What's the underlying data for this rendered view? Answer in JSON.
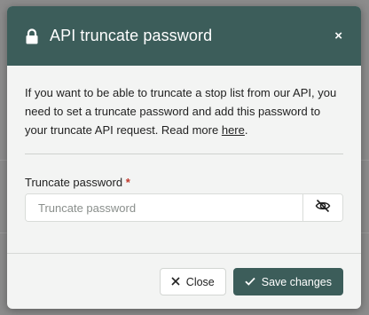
{
  "modal": {
    "title": "API truncate password",
    "close_glyph": "×",
    "header_icon": "lock-icon",
    "colors": {
      "header_bg": "#3c5d5a",
      "primary_button": "#3c5d5a",
      "required": "#c0392b"
    }
  },
  "body": {
    "intro_text": "If you want to be able to truncate a stop list from our API, you need to set a truncate password and add this password to your truncate API request. Read more ",
    "intro_link": "here",
    "intro_end": "."
  },
  "form": {
    "label": "Truncate password",
    "required_mark": "*",
    "placeholder": "Truncate password",
    "value": "",
    "toggle_icon": "eye-slash-icon"
  },
  "footer": {
    "close_label": "Close",
    "close_icon": "x-icon",
    "save_label": "Save changes",
    "save_icon": "check-icon"
  }
}
